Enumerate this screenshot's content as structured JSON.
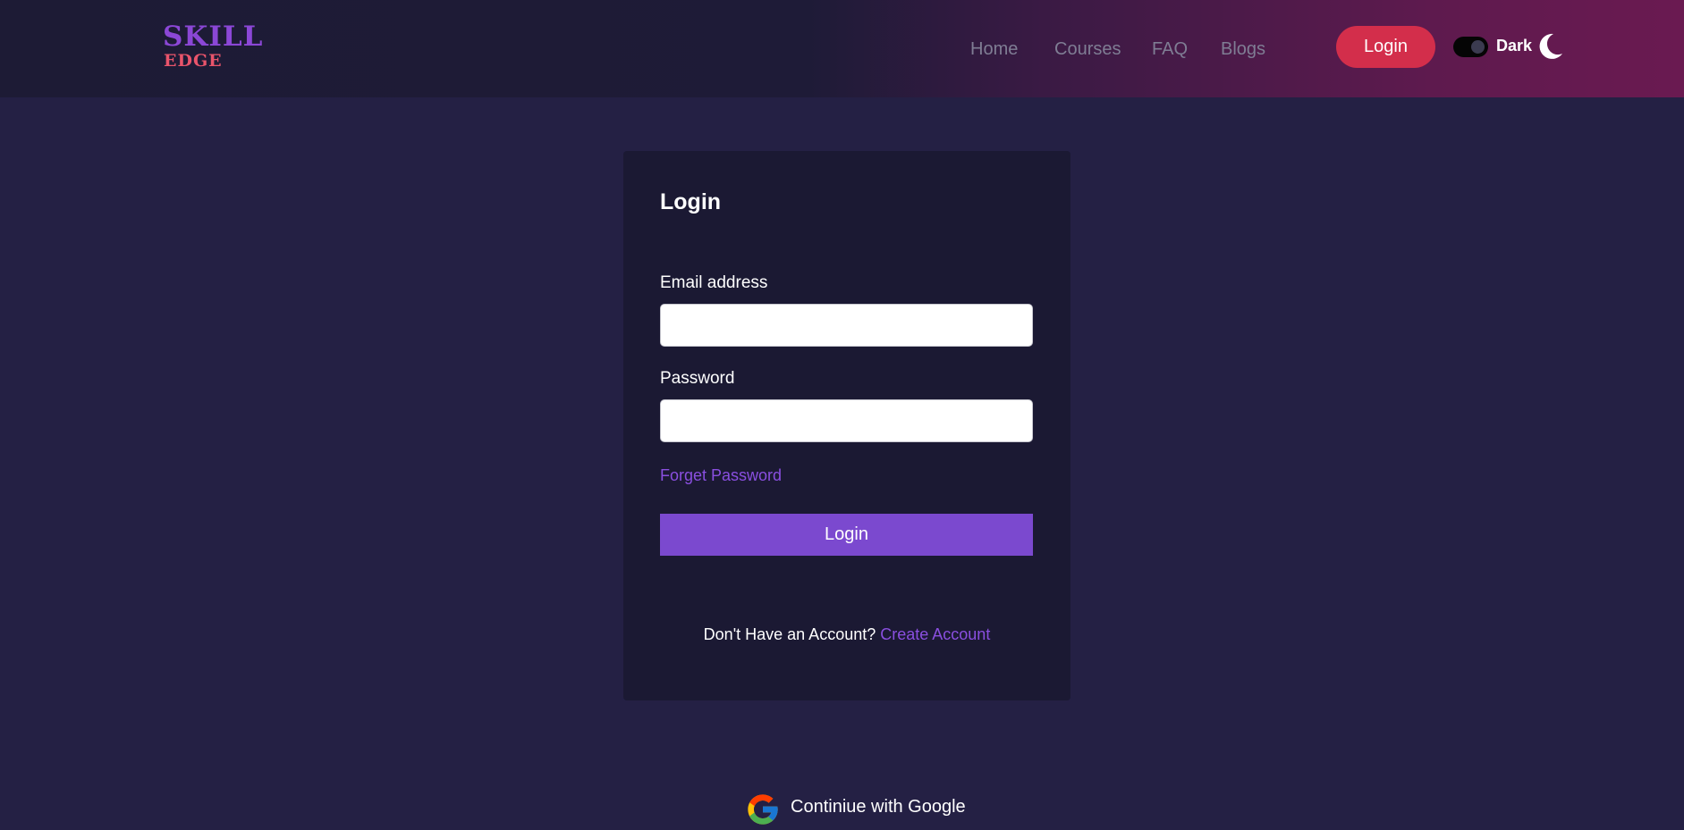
{
  "navbar": {
    "logo": {
      "line1": "SKILL",
      "line2": "EDGE"
    },
    "links": [
      {
        "label": "Home"
      },
      {
        "label": "Courses"
      },
      {
        "label": "FAQ"
      },
      {
        "label": "Blogs"
      }
    ],
    "login_button": "Login",
    "theme_toggle": {
      "label": "Dark",
      "state": "on",
      "icon": "moon-icon"
    }
  },
  "login_form": {
    "title": "Login",
    "email": {
      "label": "Email address",
      "value": "",
      "placeholder": ""
    },
    "password": {
      "label": "Password",
      "value": "",
      "placeholder": ""
    },
    "forget_password": "Forget Password",
    "submit_label": "Login",
    "signup_prompt": "Don't Have an Account?",
    "signup_link": "Create Account"
  },
  "google_signin": {
    "label": "Continiue with Google",
    "icon": "google-icon"
  },
  "colors": {
    "background": "#242044",
    "card": "#1b1933",
    "accent_purple": "#7b49cf",
    "link_purple": "#8a4fe0",
    "nav_login_red": "#d32e4b",
    "logo_purple": "#8b47d6",
    "logo_coral": "#e9546b"
  }
}
